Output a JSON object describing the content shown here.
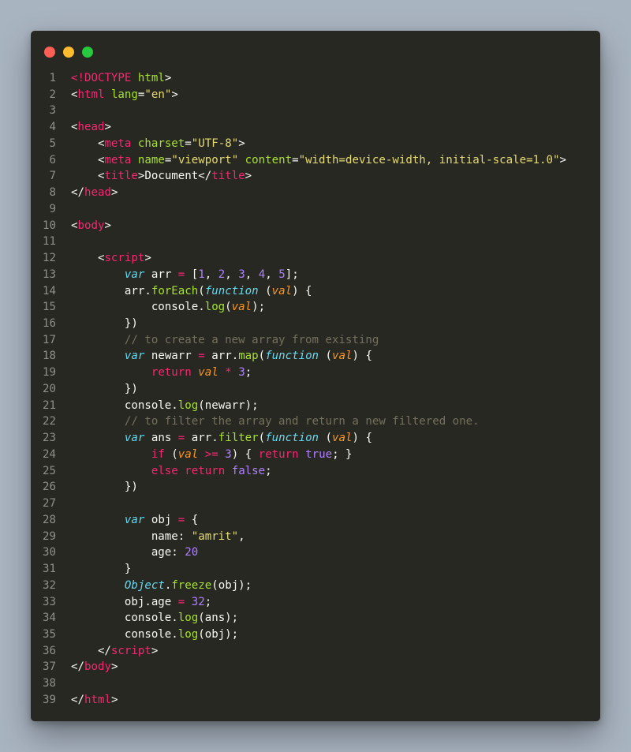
{
  "window": {
    "controls": [
      {
        "name": "close",
        "color": "#ff5f56"
      },
      {
        "name": "minimize",
        "color": "#ffbd2e"
      },
      {
        "name": "zoom",
        "color": "#27c93f"
      }
    ]
  },
  "editor": {
    "lines": [
      [
        [
          "<!",
          "tag"
        ],
        [
          "DOCTYPE",
          "tag"
        ],
        [
          " html",
          "attr"
        ],
        [
          ">",
          "plain"
        ]
      ],
      [
        [
          "<",
          "plain"
        ],
        [
          "html",
          "tag"
        ],
        [
          " lang",
          "attr"
        ],
        [
          "=",
          "plain"
        ],
        [
          "\"en\"",
          "str"
        ],
        [
          ">",
          "plain"
        ]
      ],
      [],
      [
        [
          "<",
          "plain"
        ],
        [
          "head",
          "tag"
        ],
        [
          ">",
          "plain"
        ]
      ],
      [
        [
          "    <",
          "plain"
        ],
        [
          "meta",
          "tag"
        ],
        [
          " charset",
          "attr"
        ],
        [
          "=",
          "plain"
        ],
        [
          "\"UTF-8\"",
          "str"
        ],
        [
          ">",
          "plain"
        ]
      ],
      [
        [
          "    <",
          "plain"
        ],
        [
          "meta",
          "tag"
        ],
        [
          " name",
          "attr"
        ],
        [
          "=",
          "plain"
        ],
        [
          "\"viewport\"",
          "str"
        ],
        [
          " content",
          "attr"
        ],
        [
          "=",
          "plain"
        ],
        [
          "\"width=device-width, initial-scale=1.0\"",
          "str"
        ],
        [
          ">",
          "plain"
        ]
      ],
      [
        [
          "    <",
          "plain"
        ],
        [
          "title",
          "tag"
        ],
        [
          ">Document</",
          "plain"
        ],
        [
          "title",
          "tag"
        ],
        [
          ">",
          "plain"
        ]
      ],
      [
        [
          "</",
          "plain"
        ],
        [
          "head",
          "tag"
        ],
        [
          ">",
          "plain"
        ]
      ],
      [],
      [
        [
          "<",
          "plain"
        ],
        [
          "body",
          "tag"
        ],
        [
          ">",
          "plain"
        ]
      ],
      [],
      [
        [
          "    <",
          "plain"
        ],
        [
          "script",
          "tag"
        ],
        [
          ">",
          "plain"
        ]
      ],
      [
        [
          "        ",
          "plain"
        ],
        [
          "var",
          "kw"
        ],
        [
          " arr ",
          "plain"
        ],
        [
          "=",
          "op"
        ],
        [
          " [",
          "plain"
        ],
        [
          "1",
          "num"
        ],
        [
          ", ",
          "plain"
        ],
        [
          "2",
          "num"
        ],
        [
          ", ",
          "plain"
        ],
        [
          "3",
          "num"
        ],
        [
          ", ",
          "plain"
        ],
        [
          "4",
          "num"
        ],
        [
          ", ",
          "plain"
        ],
        [
          "5",
          "num"
        ],
        [
          "];",
          "plain"
        ]
      ],
      [
        [
          "        arr.",
          "plain"
        ],
        [
          "forEach",
          "fn"
        ],
        [
          "(",
          "plain"
        ],
        [
          "function",
          "kw"
        ],
        [
          " (",
          "plain"
        ],
        [
          "val",
          "param"
        ],
        [
          ") {",
          "plain"
        ]
      ],
      [
        [
          "            console.",
          "plain"
        ],
        [
          "log",
          "fn"
        ],
        [
          "(",
          "plain"
        ],
        [
          "val",
          "param"
        ],
        [
          ");",
          "plain"
        ]
      ],
      [
        [
          "        })",
          "plain"
        ]
      ],
      [
        [
          "        ",
          "plain"
        ],
        [
          "// to create a new array from existing",
          "cmt"
        ]
      ],
      [
        [
          "        ",
          "plain"
        ],
        [
          "var",
          "kw"
        ],
        [
          " newarr ",
          "plain"
        ],
        [
          "=",
          "op"
        ],
        [
          " arr.",
          "plain"
        ],
        [
          "map",
          "fn"
        ],
        [
          "(",
          "plain"
        ],
        [
          "function",
          "kw"
        ],
        [
          " (",
          "plain"
        ],
        [
          "val",
          "param"
        ],
        [
          ") {",
          "plain"
        ]
      ],
      [
        [
          "            ",
          "plain"
        ],
        [
          "return",
          "ctrl"
        ],
        [
          " ",
          "plain"
        ],
        [
          "val",
          "param"
        ],
        [
          " ",
          "plain"
        ],
        [
          "*",
          "op"
        ],
        [
          " ",
          "plain"
        ],
        [
          "3",
          "num"
        ],
        [
          ";",
          "plain"
        ]
      ],
      [
        [
          "        })",
          "plain"
        ]
      ],
      [
        [
          "        console.",
          "plain"
        ],
        [
          "log",
          "fn"
        ],
        [
          "(newarr);",
          "plain"
        ]
      ],
      [
        [
          "        ",
          "plain"
        ],
        [
          "// to filter the array and return a new filtered one.",
          "cmt"
        ]
      ],
      [
        [
          "        ",
          "plain"
        ],
        [
          "var",
          "kw"
        ],
        [
          " ans ",
          "plain"
        ],
        [
          "=",
          "op"
        ],
        [
          " arr.",
          "plain"
        ],
        [
          "filter",
          "fn"
        ],
        [
          "(",
          "plain"
        ],
        [
          "function",
          "kw"
        ],
        [
          " (",
          "plain"
        ],
        [
          "val",
          "param"
        ],
        [
          ") {",
          "plain"
        ]
      ],
      [
        [
          "            ",
          "plain"
        ],
        [
          "if",
          "ctrl"
        ],
        [
          " (",
          "plain"
        ],
        [
          "val",
          "param"
        ],
        [
          " ",
          "plain"
        ],
        [
          ">=",
          "op"
        ],
        [
          " ",
          "plain"
        ],
        [
          "3",
          "num"
        ],
        [
          ") { ",
          "plain"
        ],
        [
          "return",
          "ctrl"
        ],
        [
          " ",
          "plain"
        ],
        [
          "true",
          "const"
        ],
        [
          "; }",
          "plain"
        ]
      ],
      [
        [
          "            ",
          "plain"
        ],
        [
          "else",
          "ctrl"
        ],
        [
          " ",
          "plain"
        ],
        [
          "return",
          "ctrl"
        ],
        [
          " ",
          "plain"
        ],
        [
          "false",
          "const"
        ],
        [
          ";",
          "plain"
        ]
      ],
      [
        [
          "        })",
          "plain"
        ]
      ],
      [],
      [
        [
          "        ",
          "plain"
        ],
        [
          "var",
          "kw"
        ],
        [
          " obj ",
          "plain"
        ],
        [
          "=",
          "op"
        ],
        [
          " {",
          "plain"
        ]
      ],
      [
        [
          "            name: ",
          "plain"
        ],
        [
          "\"amrit\"",
          "str"
        ],
        [
          ",",
          "plain"
        ]
      ],
      [
        [
          "            age: ",
          "plain"
        ],
        [
          "20",
          "num"
        ]
      ],
      [
        [
          "        }",
          "plain"
        ]
      ],
      [
        [
          "        ",
          "plain"
        ],
        [
          "Object",
          "obj"
        ],
        [
          ".",
          "plain"
        ],
        [
          "freeze",
          "fn"
        ],
        [
          "(obj);",
          "plain"
        ]
      ],
      [
        [
          "        obj.age ",
          "plain"
        ],
        [
          "=",
          "op"
        ],
        [
          " ",
          "plain"
        ],
        [
          "32",
          "num"
        ],
        [
          ";",
          "plain"
        ]
      ],
      [
        [
          "        console.",
          "plain"
        ],
        [
          "log",
          "fn"
        ],
        [
          "(ans);",
          "plain"
        ]
      ],
      [
        [
          "        console.",
          "plain"
        ],
        [
          "log",
          "fn"
        ],
        [
          "(obj);",
          "plain"
        ]
      ],
      [
        [
          "    </",
          "plain"
        ],
        [
          "script",
          "tag"
        ],
        [
          ">",
          "plain"
        ]
      ],
      [
        [
          "</",
          "plain"
        ],
        [
          "body",
          "tag"
        ],
        [
          ">",
          "plain"
        ]
      ],
      [],
      [
        [
          "</",
          "plain"
        ],
        [
          "html",
          "tag"
        ],
        [
          ">",
          "plain"
        ]
      ]
    ]
  }
}
